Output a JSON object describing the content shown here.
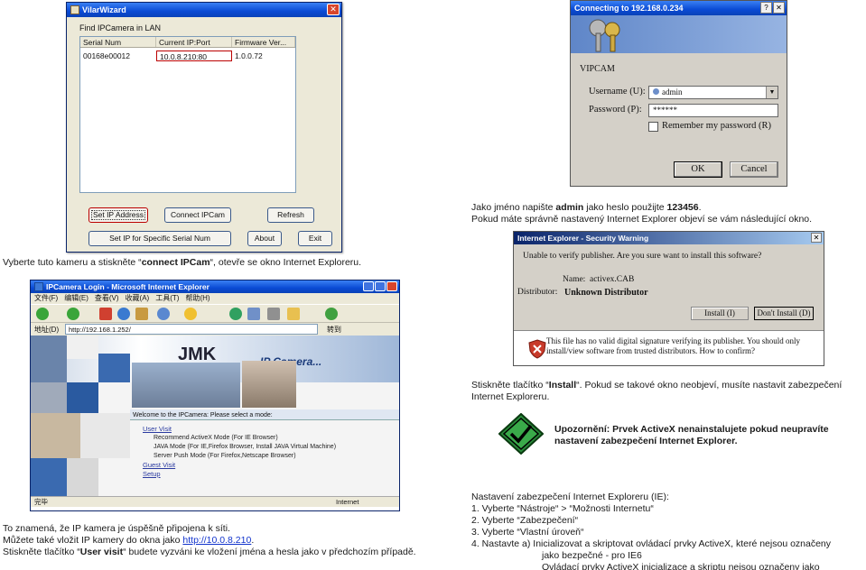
{
  "wizard": {
    "title": "VilarWizard",
    "group_label": "Find IPCamera in LAN",
    "columns": [
      "Serial Num",
      "Current IP:Port",
      "Firmware Ver..."
    ],
    "rows": [
      [
        "00168e00012",
        "10.0.8.210:80",
        "1.0.0.72"
      ]
    ],
    "buttons": {
      "set_ip": "Set IP Address",
      "connect": "Connect IPCam",
      "refresh": "Refresh",
      "set_ip_serial": "Set IP for Specific Serial Num",
      "about": "About",
      "exit": "Exit"
    }
  },
  "login": {
    "title": "Connecting to 192.168.0.234",
    "realm": "VIPCAM",
    "username_label": "Username (U):",
    "username_value": "admin",
    "password_label": "Password (P):",
    "password_value": "******",
    "remember_label": "Remember my password (R)",
    "ok": "OK",
    "cancel": "Cancel"
  },
  "browser": {
    "title": "IPCamera Login - Microsoft Internet Explorer",
    "menu": [
      "文件(F)",
      "编辑(E)",
      "查看(V)",
      "收藏(A)",
      "工具(T)",
      "帮助(H)"
    ],
    "address_label": "地址(D)",
    "address": "http://192.168.1.252/",
    "go": "转到",
    "brand": "JMK",
    "banner_title": "IP Camera...",
    "welcome": "Welcome to the IPCamera: Please select a mode:",
    "user_visit": "User Visit",
    "modes": [
      "Recommend ActiveX Mode (For IE Browser)",
      "JAVA Mode (For IE,Firefox Browser, Install JAVA Virtual Machine)",
      "Server Push Mode (For Firefox,Netscape Browser)"
    ],
    "guest_visit": "Guest Visit",
    "setup": "Setup",
    "status_left": "完毕",
    "status_right": "Internet"
  },
  "security_warning": {
    "title": "Internet Explorer - Security Warning",
    "question": "Unable to verify publisher. Are you sure want to install this software?",
    "name_label": "Name:",
    "name_value": "activex.CAB",
    "distributor_label": "Distributor:",
    "distributor_value": "Unknown Distributor",
    "install": "Install (I)",
    "dont_install": "Don't Install (D)",
    "footer": "This file has no valid digital signature verifying its publisher. You should only install/view software from trusted distributors. How to confirm?",
    "footer_link": "How to confirm?"
  },
  "text": {
    "login_hint_1_pre": "Jako jméno napište ",
    "login_hint_1_admin": "admin",
    "login_hint_1_mid": " jako heslo použijte ",
    "login_hint_1_pw": "123456",
    "login_hint_1_end": ".",
    "login_hint_2": "Pokud máte správně nastavený Internet Explorer objeví se vám následující okno.",
    "select_pre": "Vyberte tuto kameru a stiskněte “",
    "select_bold": "connect IPCam",
    "select_post": "“, otevře se okno Internet Exploreru.",
    "install_pre": "Stiskněte tlačítko “",
    "install_bold": "Install",
    "install_post": "“. Pokud se takové okno neobjeví, musíte nastavit zabezpečení Internet Exploreru.",
    "warning": "Upozornění: Prvek ActiveX nenainstalujete pokud neupravíte nastavení zabezpečení Internet Explorer.",
    "connected_1": "To znamená, že IP kamera je úspěšně připojena k síti.",
    "connected_2_pre": "Můžete také vložit IP kamery do okna jako ",
    "connected_2_link": "http://10.0.8.210",
    "connected_2_end": ".",
    "connected_3_pre": "Stiskněte tlačítko “",
    "connected_3_bold": "User visit",
    "connected_3_post": "“ budete vyzváni ke vložení jména a hesla jako v předchozím případě.",
    "ie_settings_title": "Nastavení zabezpečení Internet Exploreru (IE):",
    "ie_step_1": "1. Vyberte “Nástroje“ > “Možnosti Internetu“",
    "ie_step_2": "2. Vyberte “Zabezpečení“",
    "ie_step_3": "3. Vyberte “Vlastní úroveň“",
    "ie_step_4": "4. Nastavte  a) Inicializovat a skriptovat ovládací prvky ActiveX, které nejsou označeny",
    "ie_step_4b": "jako bezpečné - pro IE6",
    "ie_step_4c": "Ovládací prvky ActiveX inicializace a skriptu nejsou označeny jako"
  }
}
